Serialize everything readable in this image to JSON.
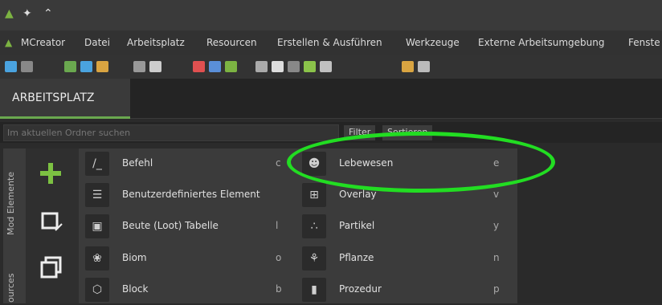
{
  "window": {
    "title_icons": [
      "mcreator-logo-icon",
      "pin-icon",
      "chevrons-up-icon"
    ]
  },
  "menu": {
    "items": [
      {
        "id": "mcreator",
        "label": "MCreator"
      },
      {
        "id": "datei",
        "label": "Datei"
      },
      {
        "id": "arbeitsplatz",
        "label": "Arbeitsplatz"
      },
      {
        "id": "resourcen",
        "label": "Resourcen"
      },
      {
        "id": "erstellen",
        "label": "Erstellen & Ausführen"
      },
      {
        "id": "werkzeuge",
        "label": "Werkzeuge"
      },
      {
        "id": "externe",
        "label": "Externe Arbeitsumgebung"
      },
      {
        "id": "fenster",
        "label": "Fenste"
      }
    ]
  },
  "tabs": {
    "active_label": "ARBEITSPLATZ"
  },
  "search": {
    "placeholder": "Im aktuellen Ordner suchen",
    "filter_label": "Filter",
    "sort_label": "Sortieren"
  },
  "sidebar": {
    "mod_elements_label": "Mod Elemente",
    "resources_label": "ources"
  },
  "elements": {
    "left": [
      {
        "label": "Befehl",
        "key": "c",
        "icon": "command-icon"
      },
      {
        "label": "Benutzerdefiniertes Element",
        "key": "",
        "icon": "custom-element-icon"
      },
      {
        "label": "Beute (Loot) Tabelle",
        "key": "l",
        "icon": "loot-table-icon"
      },
      {
        "label": "Biom",
        "key": "o",
        "icon": "biome-icon"
      },
      {
        "label": "Block",
        "key": "b",
        "icon": "block-icon"
      }
    ],
    "right": [
      {
        "label": "Lebewesen",
        "key": "e",
        "icon": "mob-icon"
      },
      {
        "label": "Overlay",
        "key": "v",
        "icon": "overlay-icon"
      },
      {
        "label": "Partikel",
        "key": "y",
        "icon": "particle-icon"
      },
      {
        "label": "Pflanze",
        "key": "n",
        "icon": "plant-icon"
      },
      {
        "label": "Prozedur",
        "key": "p",
        "icon": "procedure-icon"
      }
    ]
  },
  "colors": {
    "accent": "#6aa84f",
    "highlight_ring": "#22dd22"
  }
}
